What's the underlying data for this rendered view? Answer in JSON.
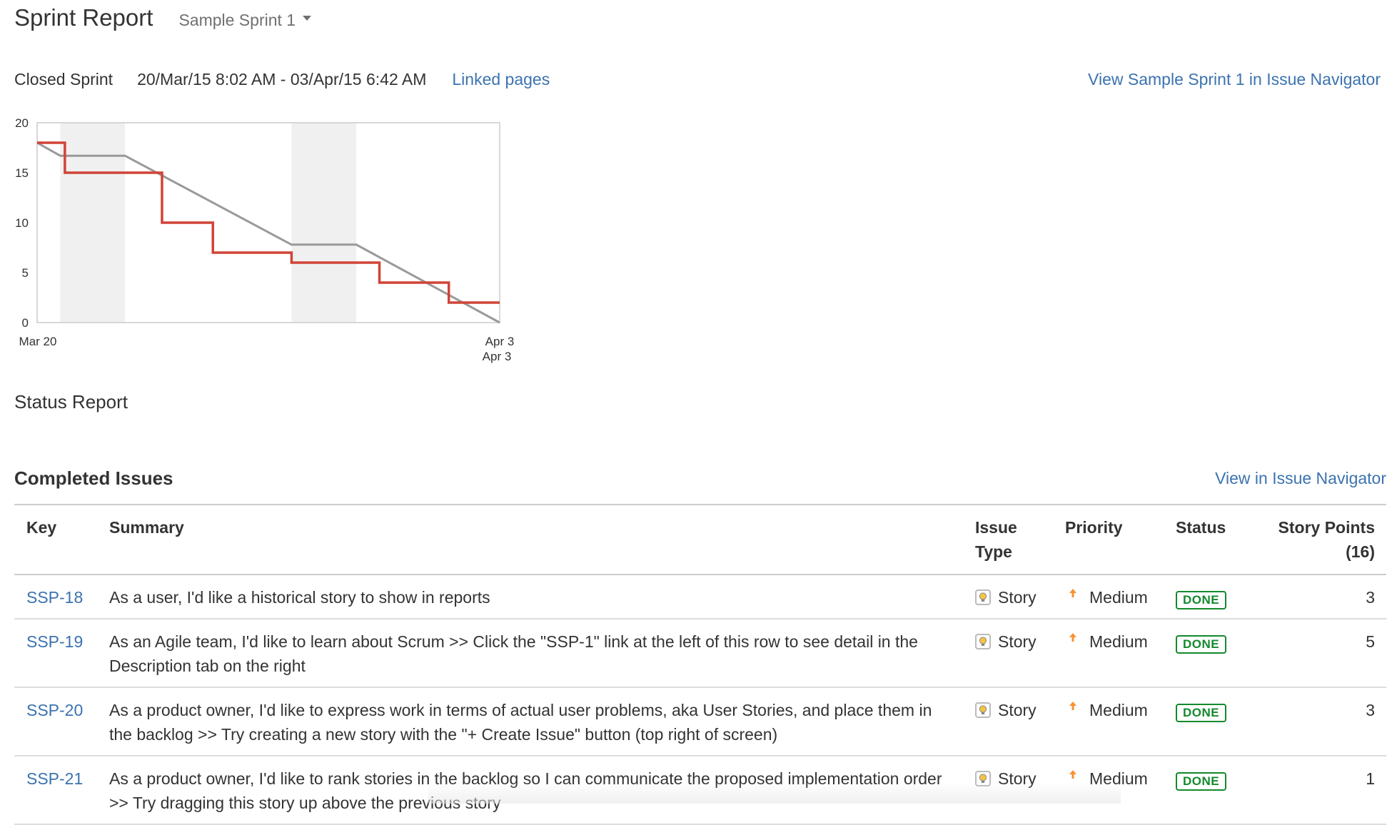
{
  "header": {
    "title": "Sprint Report",
    "sprint_selector": "Sample Sprint 1"
  },
  "meta": {
    "state": "Closed Sprint",
    "date_range": "20/Mar/15 8:02 AM - 03/Apr/15 6:42 AM",
    "linked_pages": "Linked pages",
    "view_in_navigator": "View Sample Sprint 1 in Issue Navigator"
  },
  "chart_data": {
    "type": "line",
    "title": "",
    "xlabel": "",
    "ylabel": "",
    "ylim": [
      0,
      20
    ],
    "y_ticks": [
      "20",
      "15",
      "10",
      "5",
      "0"
    ],
    "x_tick_start": "Mar 20",
    "x_tick_end": "Apr 3",
    "x_tick_end_sub": "Apr 3",
    "xlim": [
      0,
      14
    ],
    "non_working_bands": [
      [
        0.5,
        1.9
      ],
      [
        5.5,
        6.9
      ]
    ],
    "series": [
      {
        "color": "#d04437",
        "step": true,
        "points": [
          [
            0,
            18
          ],
          [
            0.6,
            18
          ],
          [
            0.6,
            15
          ],
          [
            2.7,
            15
          ],
          [
            2.7,
            10
          ],
          [
            3.8,
            10
          ],
          [
            3.8,
            7
          ],
          [
            5.5,
            7
          ],
          [
            5.5,
            6
          ],
          [
            7.4,
            6
          ],
          [
            7.4,
            4
          ],
          [
            8.9,
            4
          ],
          [
            8.9,
            2
          ],
          [
            10,
            2
          ]
        ]
      },
      {
        "color": "#999999",
        "step": false,
        "points": [
          [
            0,
            18
          ],
          [
            0.5,
            16.7
          ],
          [
            1.9,
            16.7
          ],
          [
            5.5,
            7.8
          ],
          [
            6.9,
            7.8
          ],
          [
            10,
            0
          ]
        ]
      }
    ]
  },
  "status_report": "Status Report",
  "completed": {
    "title": "Completed Issues",
    "view_link": "View in Issue Navigator",
    "columns": {
      "key": "Key",
      "summary": "Summary",
      "type_1": "Issue",
      "type_2": "Type",
      "priority": "Priority",
      "status": "Status",
      "points": "Story Points (16)"
    },
    "rows": [
      {
        "key": "SSP-18",
        "summary": "As a user, I'd like a historical story to show in reports",
        "type": "Story",
        "priority": "Medium",
        "status": "DONE",
        "points": "3"
      },
      {
        "key": "SSP-19",
        "summary": "As an Agile team, I'd like to learn about Scrum >> Click the \"SSP-1\" link at the left of this row to see detail in the Description tab on the right",
        "type": "Story",
        "priority": "Medium",
        "status": "DONE",
        "points": "5"
      },
      {
        "key": "SSP-20",
        "summary": "As a product owner, I'd like to express work in terms of actual user problems, aka User Stories, and place them in the backlog >> Try creating a new story with the \"+ Create Issue\" button (top right of screen)",
        "type": "Story",
        "priority": "Medium",
        "status": "DONE",
        "points": "3"
      },
      {
        "key": "SSP-21",
        "summary": "As a product owner, I'd like to rank stories in the backlog so I can communicate the proposed implementation order >> Try dragging this story up above the previous story",
        "type": "Story",
        "priority": "Medium",
        "status": "DONE",
        "points": "1"
      }
    ]
  },
  "colors": {
    "link": "#3b73af",
    "done": "#14892c",
    "burndown": "#d04437",
    "guideline": "#999999",
    "priority_medium": "#f79232"
  },
  "icons": {
    "story": "story-lightbulb-icon",
    "priority": "priority-medium-arrow-icon",
    "dropdown": "caret-down-icon"
  }
}
